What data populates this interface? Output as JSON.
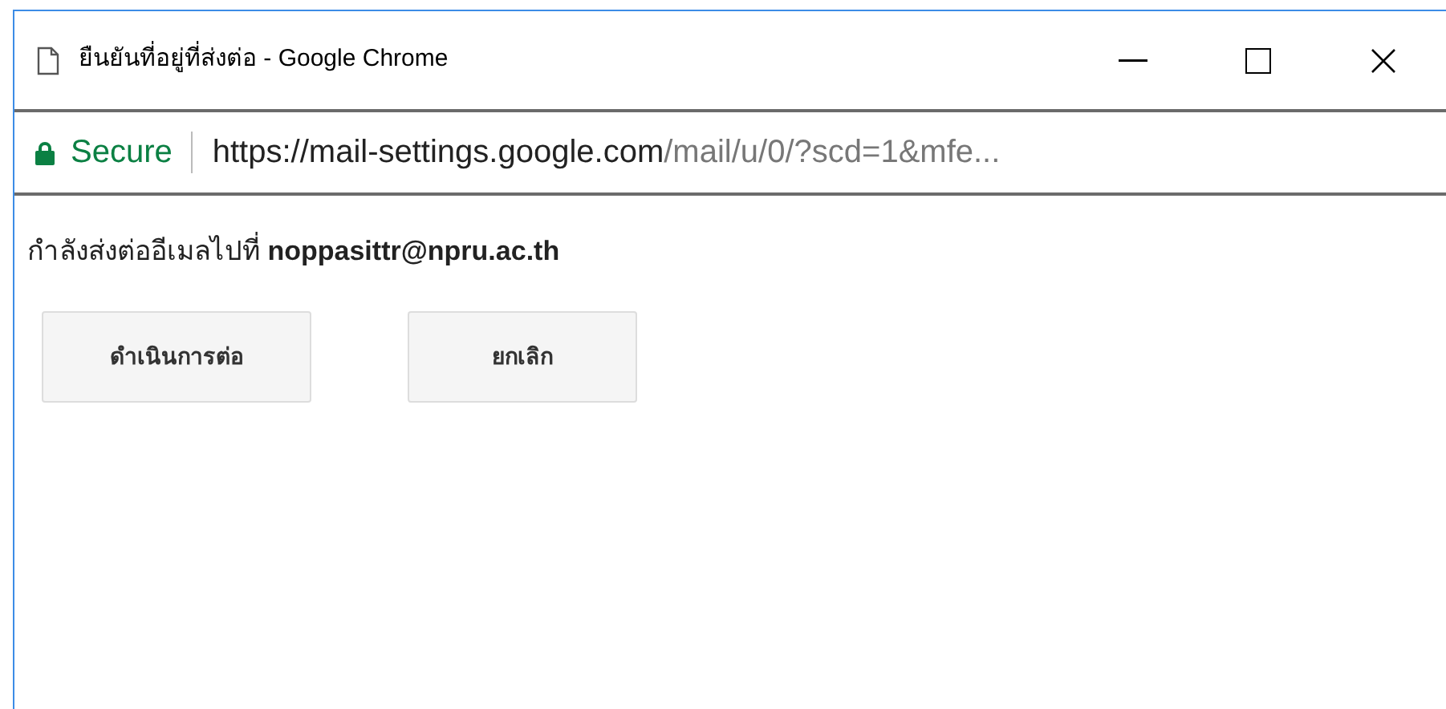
{
  "window": {
    "title": "ยืนยันที่อยู่ที่ส่งต่อ - Google Chrome"
  },
  "address_bar": {
    "security": "Secure",
    "url_host": "https://mail-settings.google.com",
    "url_path": "/mail/u/0/?scd=1&mfe..."
  },
  "message": "กำลังส่งต่ออีเมลไปที่ **noppasittr@npru.ac.th**",
  "buttons": [
    "ดำเนินการต่อ",
    "ยกเลิก"
  ]
}
